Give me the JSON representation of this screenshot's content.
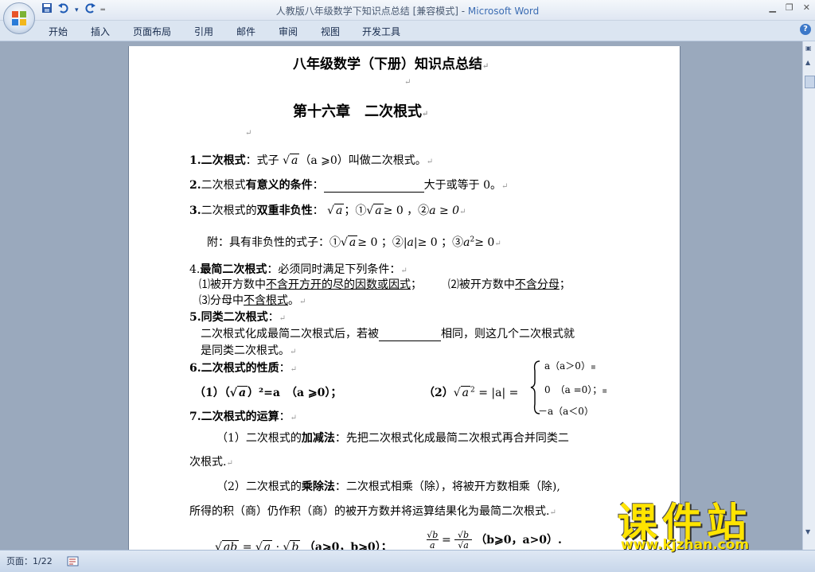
{
  "window": {
    "title": "人教版八年级数学下知识点总结 [兼容模式] - ",
    "app_name": "Microsoft Word"
  },
  "qat": {
    "save_icon": "save-icon",
    "undo_icon": "undo-icon",
    "redo_icon": "redo-icon",
    "more": "▾"
  },
  "ribbon": {
    "tabs": [
      "开始",
      "插入",
      "页面布局",
      "引用",
      "邮件",
      "审阅",
      "视图",
      "开发工具"
    ],
    "help": "?"
  },
  "doc": {
    "title": "八年级数学（下册）知识点总结",
    "chapter": "第十六章　二次根式",
    "s1": {
      "num": "1.",
      "term": "二次根式",
      "text1": "：式子 ",
      "rad": "a",
      "text2": "（a ⩾0）叫做二次根式。"
    },
    "s2": {
      "num": "2.",
      "pre": "二次根式",
      "term": "有意义的条件",
      "colon": "：",
      "post": "大于或等于 0。"
    },
    "s3": {
      "num": "3.",
      "pre": "二次根式的",
      "term": "双重非负性",
      "colon": "：",
      "rad": "a",
      "t1": "；①",
      "t2": "≥ 0 ，②",
      "t3": "a ≥ 0"
    },
    "s3b": {
      "text": "附：具有非负性的式子：①",
      "rad": "a",
      "t1": "≥ 0 ；②",
      "t2": "|a|",
      "t3": "≥ 0 ；③",
      "t4": "a",
      "t5": "2",
      "t6": "≥ 0"
    },
    "s4": {
      "num": "4.",
      "term": "最简二次根式",
      "text": "：必须同时满足下列条件：",
      "c1a": "⑴被开方数中",
      "c1b": "不含开方开的尽的因数或因式",
      "c1c": "；",
      "c2a": "⑵被开方数中",
      "c2b": "不含分母",
      "c2c": "；",
      "c3a": "⑶分母中",
      "c3b": "不含根式",
      "c3c": "。"
    },
    "s5": {
      "num": "5.",
      "term": "同类二次根式",
      "colon": "：",
      "l1a": "二次根式化成最简二次根式后，若被",
      "l1b": "相同，则这几个二次根式就",
      "l2": "是同类二次根式。"
    },
    "s6": {
      "num": "6.",
      "term": "二次根式的性质",
      "colon": "：",
      "p1a": "（1）（",
      "p1rad": "a",
      "p1b": "）²=a　（a ⩾0）；",
      "p2a": "（2）",
      "p2rad": "a",
      "p2sup": "2",
      "p2eq": "= |a| =",
      "case1": "a（a＞0）",
      "case2": "0　（a =0）；",
      "case3": "－a（a＜0）"
    },
    "s7": {
      "num": "7.",
      "term": "二次根式的运算",
      "colon": "：",
      "add_a": "（1）二次根式的",
      "add_term": "加减法",
      "add_b": "：先把二次根式化成最简二次根式再合并同类二",
      "add_c": "次根式.",
      "mul_a": "（2）二次根式的",
      "mul_term": "乘除法",
      "mul_b": "：二次根式相乘（除），将被开方数相乘（除),",
      "mul_c": "所得的积（商）仍作积（商）的被开方数并将运算结果化为最简二次根式.",
      "f1a": "ab",
      "f1b": "=",
      "f1c": "a",
      "f1d": "·",
      "f1e": "b",
      "f1f": "（a⩾0，b⩾0）；",
      "f2num": "b",
      "f2den": "a",
      "f2eq": "=",
      "f2num2": "b",
      "f2den2": "a",
      "f2f": "（b⩾0，a>0）."
    }
  },
  "status": {
    "page": "页面：1/22"
  },
  "watermark": {
    "big": "课件站",
    "small": "www.kjzhan.com"
  }
}
